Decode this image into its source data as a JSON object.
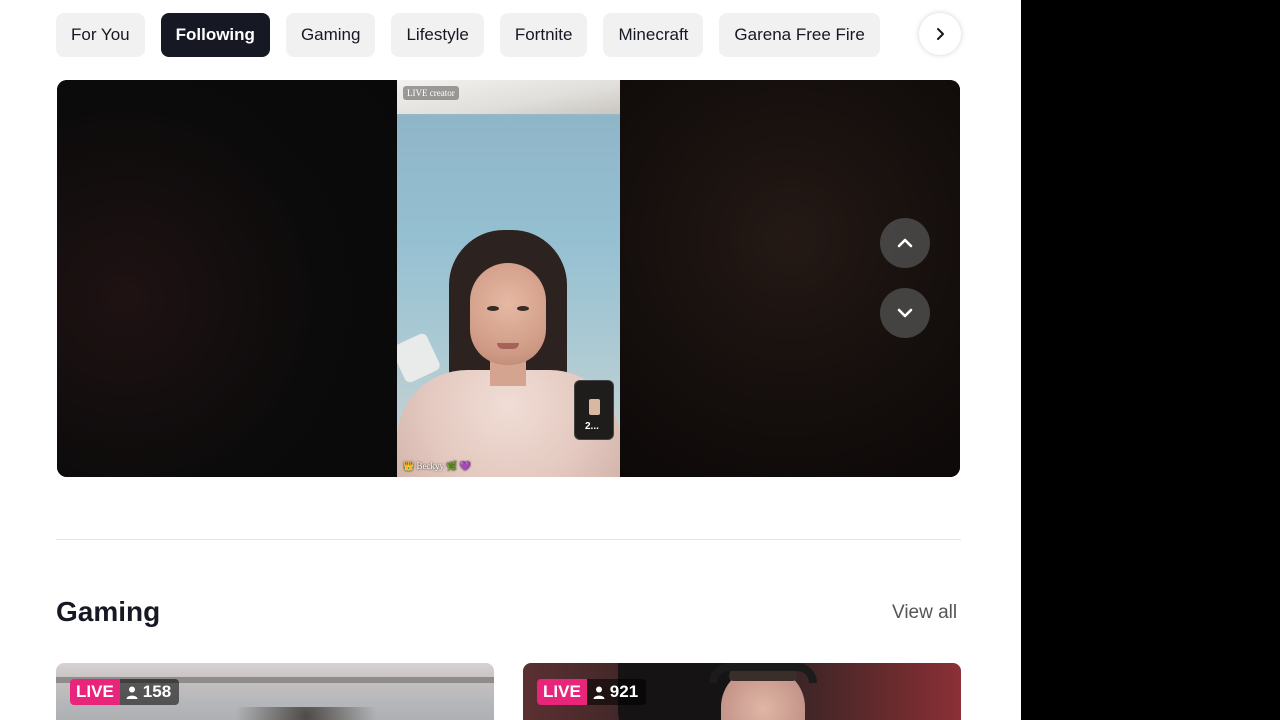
{
  "categories": {
    "chips": [
      {
        "label": "For You",
        "active": false
      },
      {
        "label": "Following",
        "active": true
      },
      {
        "label": "Gaming",
        "active": false
      },
      {
        "label": "Lifestyle",
        "active": false
      },
      {
        "label": "Fortnite",
        "active": false
      },
      {
        "label": "Minecraft",
        "active": false
      },
      {
        "label": "Garena Free Fire",
        "active": false
      }
    ],
    "next_icon": "chevron-right-icon"
  },
  "player": {
    "live_creator_label": "LIVE creator",
    "guest_name": "2...",
    "caption": "👑 Beckyy 🌿 💜",
    "nav_up_icon": "chevron-up-icon",
    "nav_down_icon": "chevron-down-icon"
  },
  "gaming_section": {
    "title": "Gaming",
    "view_all": "View all",
    "cards": [
      {
        "live_label": "LIVE",
        "viewers": "158",
        "viewer_icon": "person-icon"
      },
      {
        "live_label": "LIVE",
        "viewers": "921",
        "viewer_icon": "person-icon"
      }
    ]
  },
  "colors": {
    "active_chip": "#161823",
    "chip_bg": "#f1f1f2",
    "live_badge": "#e8257a"
  }
}
